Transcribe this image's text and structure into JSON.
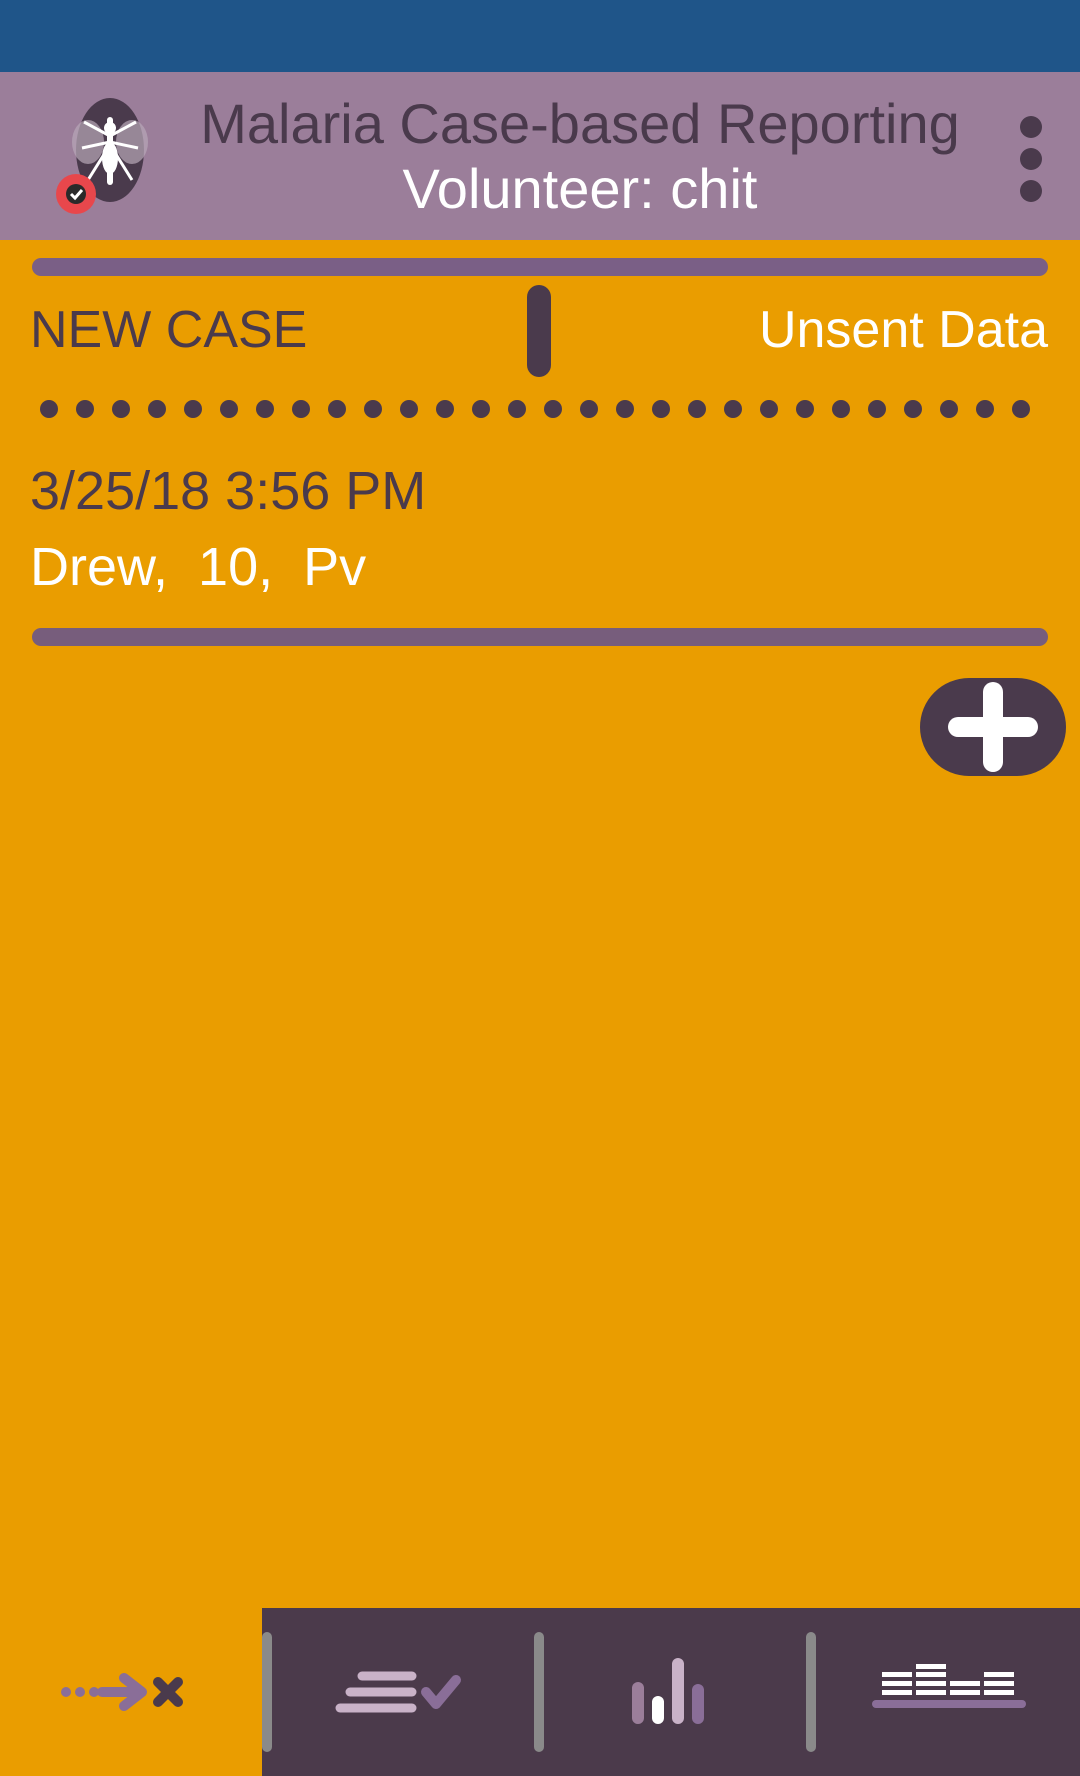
{
  "app_bar": {
    "title": "Malaria Case-based Reporting",
    "subtitle": "Volunteer: chit",
    "logo_icon": "mosquito-icon",
    "menu_icon": "more-vert-icon"
  },
  "toggle": {
    "left_label": "NEW CASE",
    "right_label": "Unsent Data"
  },
  "cases": [
    {
      "datetime": "3/25/18 3:56 PM",
      "summary": "Drew,  10,  Pv"
    }
  ],
  "fab": {
    "icon": "plus-icon"
  },
  "bottom_nav": {
    "tabs": [
      {
        "icon": "send-cancel-icon",
        "active": true
      },
      {
        "icon": "list-check-icon",
        "active": false
      },
      {
        "icon": "bar-chart-icon",
        "active": false
      },
      {
        "icon": "table-chart-icon",
        "active": false
      }
    ]
  },
  "colors": {
    "status_bar": "#1F5589",
    "app_bar": "#9B7E9A",
    "background": "#EA9D00",
    "dark_purple": "#4A3A4C",
    "accent_purple": "#7A5F86",
    "text_white": "#FFFFFF"
  }
}
